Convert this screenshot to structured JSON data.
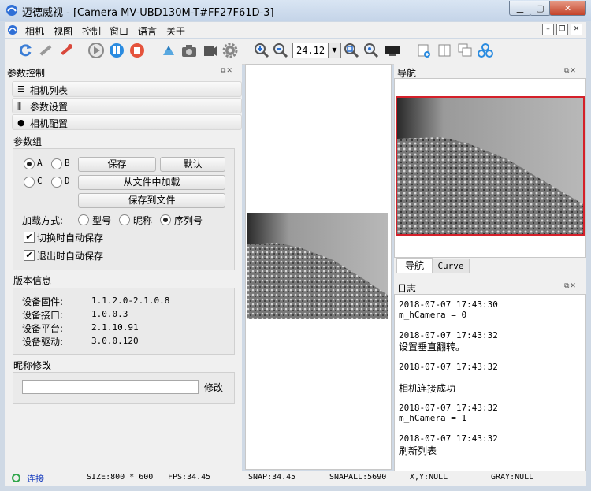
{
  "window": {
    "title": "迈德威视 - [Camera MV-UBD130M-T#FF27F61D-3]"
  },
  "menu": [
    "相机",
    "视图",
    "控制",
    "窗口",
    "语言",
    "关于"
  ],
  "toolbar": {
    "zoom_value": "24.12"
  },
  "left": {
    "title": "参数控制",
    "tool_buttons": [
      {
        "icon": "list-icon",
        "label": "相机列表"
      },
      {
        "icon": "sliders-icon",
        "label": "参数设置"
      },
      {
        "icon": "chat-icon",
        "label": "相机配置"
      }
    ],
    "param_group": {
      "title": "参数组",
      "slots": [
        "A",
        "B",
        "C",
        "D"
      ],
      "selected": "A",
      "save": "保存",
      "default": "默认",
      "load_file": "从文件中加载",
      "save_file": "保存到文件",
      "load_mode_label": "加载方式:",
      "load_modes": [
        "型号",
        "昵称",
        "序列号"
      ],
      "load_mode_selected": "序列号",
      "auto_save_switch": "切换时自动保存",
      "auto_save_exit": "退出时自动保存"
    },
    "version": {
      "title": "版本信息",
      "rows": [
        {
          "label": "设备固件:",
          "value": "1.1.2.0-2.1.0.8"
        },
        {
          "label": "设备接口:",
          "value": "1.0.0.3"
        },
        {
          "label": "设备平台:",
          "value": "2.1.10.91"
        },
        {
          "label": "设备驱动:",
          "value": "3.0.0.120"
        }
      ]
    },
    "nickname": {
      "title": "昵称修改",
      "value": "",
      "button": "修改"
    }
  },
  "right": {
    "nav_title": "导航",
    "tabs": [
      "导航",
      "Curve"
    ],
    "active_tab": "导航",
    "log_title": "日志",
    "log": [
      "2018-07-07 17:43:30",
      "m_hCamera = 0",
      "",
      "2018-07-07 17:43:32",
      "设置垂直翻转。",
      "",
      "2018-07-07 17:43:32",
      "",
      "相机连接成功",
      "",
      "2018-07-07 17:43:32",
      "m_hCamera = 1",
      "",
      "2018-07-07 17:43:32",
      "刷新列表"
    ]
  },
  "status": {
    "connection": "连接",
    "size": "SIZE:800 * 600",
    "fps": "FPS:34.45",
    "snap": "SNAP:34.45",
    "snapall": "SNAPALL:5690",
    "xy": "X,Y:NULL",
    "gray": "GRAY:NULL"
  },
  "colors": {
    "accent": "#d4202a",
    "status_ok": "#2fa64a",
    "status_text": "#1a3fbf"
  }
}
